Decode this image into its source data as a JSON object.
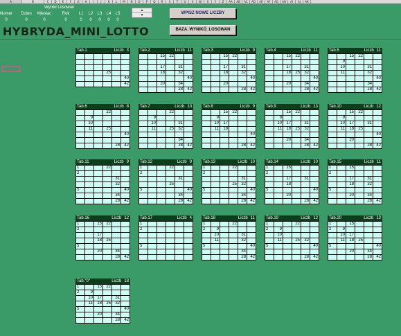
{
  "columns": [
    "A",
    "B",
    "C",
    "D",
    "E",
    "F",
    "G",
    "H",
    "I",
    "J",
    "K",
    "L",
    "M",
    "N",
    "O",
    "P",
    "Q",
    "R",
    "S",
    "T",
    "U",
    "V",
    "W",
    "X",
    "Y",
    "Z",
    "AA",
    "AB",
    "AC",
    "AD",
    "AE",
    "AF",
    "AG",
    "AH",
    "AI",
    "AJ",
    "AK"
  ],
  "params": {
    "title": "Wyniki Losowan",
    "headers": [
      "Numer",
      "Dzien",
      "Miesiac",
      "Rok",
      "L1",
      "L2",
      "L3",
      "L4",
      "L5"
    ],
    "values": [
      "0",
      "0",
      "0",
      "0",
      "0",
      "0",
      "0",
      "0",
      "0"
    ]
  },
  "spinner": {
    "up": "▲",
    "down": "▼"
  },
  "buttons": {
    "new_numbers": "WPISZ NOWE LICZBY",
    "results_base": "BAZA_WYNIKÓ_LOSOWAN"
  },
  "app_title": "HYBRYDA_MINI_LOTTO",
  "tables": [
    {
      "name": "Tab.1",
      "count_label": "Liczb",
      "count": "3",
      "rows": [
        [
          "",
          "",
          "",
          "",
          "",
          ""
        ],
        [
          "",
          "",
          "",
          "",
          "",
          ""
        ],
        [
          "",
          "",
          "",
          "",
          "",
          ""
        ],
        [
          "",
          "",
          "",
          "25",
          "",
          ""
        ],
        [
          "",
          "",
          "",
          "",
          "",
          "40"
        ],
        [
          "",
          "",
          "",
          "",
          "",
          "42"
        ]
      ]
    },
    {
      "name": "Tab.2",
      "count_label": "Liczb",
      "count": "11",
      "rows": [
        [
          "",
          "",
          "15",
          "22",
          "",
          ""
        ],
        [
          "",
          "",
          "",
          "",
          "",
          ""
        ],
        [
          "",
          "",
          "17",
          "",
          "31",
          ""
        ],
        [
          "",
          "",
          "18",
          "",
          "32",
          ""
        ],
        [
          "",
          "",
          "",
          "",
          "",
          "40"
        ],
        [
          "",
          "",
          "20",
          "",
          "34",
          ""
        ],
        [
          "",
          "",
          "",
          "",
          "28",
          "42"
        ]
      ]
    },
    {
      "name": "Tab.3",
      "count_label": "Liczb",
      "count": "9",
      "rows": [
        [
          "",
          "",
          "15",
          "22",
          "",
          ""
        ],
        [
          "",
          "",
          "",
          "",
          "",
          ""
        ],
        [
          "",
          "",
          "17",
          "",
          "31",
          ""
        ],
        [
          "",
          "",
          "18",
          "",
          "32",
          ""
        ],
        [
          "",
          "",
          "",
          "",
          "",
          "40"
        ],
        [
          "",
          "",
          "20",
          "",
          "",
          ""
        ],
        [
          "",
          "",
          "",
          "",
          "28",
          "42"
        ]
      ]
    },
    {
      "name": "Tab.4",
      "count_label": "Liczb",
      "count": "11",
      "rows": [
        [
          "",
          "",
          "15",
          "22",
          "",
          ""
        ],
        [
          "",
          "",
          "",
          "",
          "",
          ""
        ],
        [
          "",
          "",
          "17",
          "",
          "31",
          ""
        ],
        [
          "",
          "",
          "18",
          "25",
          "32",
          ""
        ],
        [
          "",
          "",
          "",
          "",
          "",
          "40"
        ],
        [
          "",
          "",
          "20",
          "",
          "34",
          ""
        ],
        [
          "",
          "",
          "",
          "",
          "28",
          "42"
        ]
      ]
    },
    {
      "name": "Tab.5",
      "count_label": "Liczb",
      "count": "11",
      "rows": [
        [
          "",
          "",
          "15",
          "22",
          "",
          ""
        ],
        [
          "",
          "9",
          "",
          "",
          "",
          ""
        ],
        [
          "",
          "10",
          "",
          "",
          "31",
          ""
        ],
        [
          "",
          "11",
          "",
          "",
          "32",
          ""
        ],
        [
          "",
          "",
          "",
          "",
          "",
          "40"
        ],
        [
          "",
          "",
          "",
          "",
          "34",
          ""
        ],
        [
          "",
          "",
          "",
          "",
          "28",
          "42"
        ]
      ]
    },
    {
      "name": "Tab.6",
      "count_label": "Liczb",
      "count": "8",
      "rows": [
        [
          "",
          "",
          "",
          "22",
          "",
          ""
        ],
        [
          "",
          "9",
          "",
          "",
          "",
          ""
        ],
        [
          "",
          "10",
          "",
          "",
          "",
          ""
        ],
        [
          "",
          "11",
          "",
          "25",
          "",
          ""
        ],
        [
          "",
          "",
          "",
          "",
          "",
          "40"
        ],
        [
          "",
          "",
          "",
          "",
          "",
          ""
        ],
        [
          "",
          "",
          "",
          "",
          "28",
          "42"
        ]
      ]
    },
    {
      "name": "Tab.7",
      "count_label": "Liczb",
      "count": "10",
      "rows": [
        [
          "",
          "",
          "",
          "22",
          "",
          ""
        ],
        [
          "",
          "9",
          "",
          "",
          "",
          ""
        ],
        [
          "",
          "10",
          "",
          "",
          "31",
          ""
        ],
        [
          "",
          "11",
          "",
          "25",
          "32",
          ""
        ],
        [
          "",
          "",
          "",
          "",
          "",
          ""
        ],
        [
          "",
          "",
          "",
          "",
          "34",
          ""
        ],
        [
          "",
          "",
          "",
          "",
          "28",
          "42"
        ]
      ]
    },
    {
      "name": "Tab.8",
      "count_label": "Liczb",
      "count": "9",
      "rows": [
        [
          "",
          "",
          "15",
          "22",
          "",
          ""
        ],
        [
          "",
          "9",
          "",
          "",
          "",
          ""
        ],
        [
          "",
          "10",
          "17",
          "",
          "",
          ""
        ],
        [
          "",
          "11",
          "18",
          "",
          "",
          ""
        ],
        [
          "",
          "",
          "",
          "",
          "",
          "40"
        ],
        [
          "",
          "",
          "",
          "",
          "",
          ""
        ],
        [
          "",
          "",
          "",
          "",
          "28",
          "42"
        ]
      ]
    },
    {
      "name": "Tab.9",
      "count_label": "Liczb",
      "count": "13",
      "rows": [
        [
          "",
          "",
          "15",
          "22",
          "",
          ""
        ],
        [
          "",
          "9",
          "",
          "",
          "",
          ""
        ],
        [
          "",
          "10",
          "17",
          "",
          "31",
          ""
        ],
        [
          "",
          "11",
          "18",
          "25",
          "32",
          ""
        ],
        [
          "",
          "",
          "",
          "",
          "",
          ""
        ],
        [
          "",
          "",
          "20",
          "",
          "34",
          ""
        ],
        [
          "",
          "",
          "",
          "",
          "28",
          "42"
        ]
      ]
    },
    {
      "name": "Tab.10",
      "count_label": "Liczb",
      "count": "12",
      "rows": [
        [
          "",
          "",
          "15",
          "22",
          "",
          ""
        ],
        [
          "",
          "9",
          "",
          "",
          "",
          ""
        ],
        [
          "",
          "10",
          "17",
          "",
          "31",
          ""
        ],
        [
          "",
          "11",
          "18",
          "25",
          "",
          ""
        ],
        [
          "",
          "",
          "",
          "",
          "",
          "40"
        ],
        [
          "",
          "",
          "20",
          "",
          "",
          ""
        ],
        [
          "",
          "",
          "",
          "",
          "28",
          "42"
        ]
      ]
    },
    {
      "name": "Tab.11",
      "count_label": "Liczb",
      "count": "9",
      "rows": [
        [
          "1",
          "",
          "",
          "22",
          "",
          ""
        ],
        [
          "2",
          "",
          "",
          "",
          "",
          ""
        ],
        [
          "",
          "",
          "",
          "",
          "31",
          ""
        ],
        [
          "",
          "",
          "",
          "",
          "32",
          ""
        ],
        [
          "5",
          "",
          "",
          "",
          "",
          "40"
        ],
        [
          "",
          "",
          "",
          "",
          "34",
          ""
        ],
        [
          "",
          "",
          "",
          "",
          "28",
          "42"
        ]
      ]
    },
    {
      "name": "Tab.12",
      "count_label": "Liczb",
      "count": "9",
      "rows": [
        [
          "1",
          "",
          "",
          "22",
          "",
          ""
        ],
        [
          "2",
          "",
          "",
          "",
          "",
          ""
        ],
        [
          "",
          "",
          "",
          "",
          "31",
          ""
        ],
        [
          "",
          "",
          "",
          "25",
          "",
          ""
        ],
        [
          "5",
          "",
          "",
          "",
          "",
          "40"
        ],
        [
          "",
          "",
          "",
          "",
          "34",
          ""
        ],
        [
          "",
          "",
          "",
          "",
          "28",
          "42"
        ]
      ]
    },
    {
      "name": "Tab.13",
      "count_label": "Liczb",
      "count": "10",
      "rows": [
        [
          "1",
          "",
          "",
          "22",
          "",
          ""
        ],
        [
          "2",
          "",
          "",
          "",
          "",
          ""
        ],
        [
          "",
          "",
          "",
          "",
          "31",
          ""
        ],
        [
          "",
          "",
          "",
          "25",
          "32",
          ""
        ],
        [
          "5",
          "",
          "",
          "",
          "",
          "40"
        ],
        [
          "",
          "",
          "",
          "",
          "34",
          ""
        ],
        [
          "",
          "",
          "",
          "",
          "28",
          "42"
        ]
      ]
    },
    {
      "name": "Tab.14",
      "count_label": "Liczb",
      "count": "10",
      "rows": [
        [
          "1",
          "",
          "15",
          "",
          "",
          ""
        ],
        [
          "2",
          "",
          "",
          "",
          "",
          ""
        ],
        [
          "",
          "",
          "17",
          "",
          "31",
          ""
        ],
        [
          "",
          "",
          "18",
          "",
          "",
          ""
        ],
        [
          "5",
          "",
          "",
          "",
          "",
          "40"
        ],
        [
          "",
          "",
          "20",
          "",
          "",
          ""
        ],
        [
          "",
          "",
          "",
          "",
          "28",
          "42"
        ]
      ]
    },
    {
      "name": "Tab.15",
      "count_label": "Liczb",
      "count": "11",
      "rows": [
        [
          "1",
          "",
          "15",
          "",
          "",
          ""
        ],
        [
          "2",
          "",
          "",
          "",
          "",
          ""
        ],
        [
          "",
          "",
          "17",
          "",
          "31",
          ""
        ],
        [
          "",
          "",
          "18",
          "",
          "32",
          ""
        ],
        [
          "5",
          "",
          "",
          "",
          "",
          ""
        ],
        [
          "",
          "",
          "20",
          "",
          "34",
          ""
        ],
        [
          "",
          "",
          "",
          "",
          "28",
          "42"
        ]
      ]
    },
    {
      "name": "Tab.16",
      "count_label": "Liczb",
      "count": "12",
      "rows": [
        [
          "1",
          "",
          "15",
          "22",
          "",
          ""
        ],
        [
          "2",
          "",
          "",
          "",
          "",
          ""
        ],
        [
          "",
          "",
          "17",
          "",
          "",
          ""
        ],
        [
          "",
          "",
          "18",
          "25",
          "",
          ""
        ],
        [
          "5",
          "",
          "",
          "",
          "",
          ""
        ],
        [
          "",
          "",
          "20",
          "",
          "34",
          ""
        ],
        [
          "",
          "",
          "",
          "",
          "28",
          "42"
        ]
      ]
    },
    {
      "name": "Tab.17",
      "count_label": "Liczb",
      "count": "4",
      "rows": [
        [
          "1",
          "",
          "",
          "",
          "",
          ""
        ],
        [
          "2",
          "",
          "",
          "",
          "",
          ""
        ],
        [
          "",
          "",
          "",
          "",
          "",
          ""
        ],
        [
          "",
          "",
          "",
          "",
          "",
          ""
        ],
        [
          "5",
          "",
          "",
          "",
          "",
          ""
        ],
        [
          "",
          "",
          "",
          "",
          "",
          ""
        ],
        [
          "",
          "",
          "",
          "",
          "",
          ""
        ]
      ]
    },
    {
      "name": "Tab.18",
      "count_label": "Liczb",
      "count": "11",
      "rows": [
        [
          "1",
          "",
          "",
          "22",
          "",
          ""
        ],
        [
          "2",
          "9",
          "",
          "",
          "",
          ""
        ],
        [
          "",
          "10",
          "",
          "",
          "31",
          ""
        ],
        [
          "",
          "11",
          "",
          "",
          "32",
          ""
        ],
        [
          "5",
          "",
          "",
          "",
          "",
          "40"
        ],
        [
          "",
          "",
          "",
          "",
          "34",
          ""
        ],
        [
          "",
          "",
          "",
          "",
          "28",
          "42"
        ]
      ]
    },
    {
      "name": "Tab.19",
      "count_label": "Liczb",
      "count": "12",
      "rows": [
        [
          "1",
          "",
          "",
          "22",
          "",
          ""
        ],
        [
          "2",
          "9",
          "",
          "",
          "",
          ""
        ],
        [
          "",
          "10",
          "",
          "",
          "",
          ""
        ],
        [
          "",
          "11",
          "",
          "25",
          "32",
          ""
        ],
        [
          "5",
          "",
          "",
          "",
          "",
          "40"
        ],
        [
          "",
          "",
          "",
          "",
          "",
          ""
        ],
        [
          "",
          "",
          "",
          "",
          "28",
          "42"
        ]
      ]
    },
    {
      "name": "Tab.20",
      "count_label": "Liczb",
      "count": "13",
      "rows": [
        [
          "1",
          "",
          "15",
          "",
          "",
          ""
        ],
        [
          "2",
          "9",
          "",
          "",
          "",
          ""
        ],
        [
          "",
          "10",
          "17",
          "",
          "",
          ""
        ],
        [
          "",
          "11",
          "18",
          "25",
          "",
          ""
        ],
        [
          "5",
          "",
          "",
          "",
          "",
          "40"
        ],
        [
          "",
          "",
          "20",
          "",
          "34",
          ""
        ],
        [
          "",
          "",
          "",
          "",
          "28",
          "42"
        ]
      ]
    },
    {
      "name": "Tab.\"0\"",
      "count_label": "Liczb",
      "count": "18",
      "rows": [
        [
          "1",
          "",
          "15",
          "22",
          "",
          ""
        ],
        [
          "2",
          "9",
          "",
          "",
          "",
          ""
        ],
        [
          "",
          "10",
          "17",
          "",
          "31",
          ""
        ],
        [
          "",
          "11",
          "18",
          "25",
          "32",
          ""
        ],
        [
          "5",
          "",
          "",
          "",
          "",
          "40"
        ],
        [
          "",
          "",
          "20",
          "",
          "34",
          ""
        ],
        [
          "",
          "",
          "",
          "",
          "28",
          "42"
        ]
      ]
    }
  ]
}
